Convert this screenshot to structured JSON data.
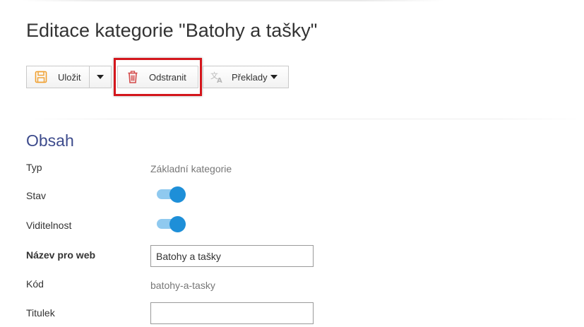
{
  "page": {
    "title": "Editace kategorie \"Batohy a tašky\""
  },
  "toolbar": {
    "save_label": "Uložit",
    "delete_label": "Odstranit",
    "translations_label": "Překlady",
    "icons": {
      "save": "floppy-disk-icon",
      "delete": "trash-icon",
      "translations": "translate-icon"
    },
    "highlight_color": "#d4161c"
  },
  "content": {
    "section_title": "Obsah",
    "fields": {
      "type": {
        "label": "Typ",
        "value": "Základní kategorie"
      },
      "status": {
        "label": "Stav",
        "enabled": true
      },
      "visibility": {
        "label": "Viditelnost",
        "enabled": true
      },
      "web_name": {
        "label": "Název pro web",
        "value": "Batohy a tašky"
      },
      "code": {
        "label": "Kód",
        "value": "batohy-a-tasky"
      },
      "title": {
        "label": "Titulek",
        "value": ""
      }
    }
  },
  "colors": {
    "section_title": "#3d4b8c",
    "toggle_knob": "#1e8fd8",
    "toggle_track": "#8fc9ef",
    "save_icon": "#f0a030",
    "delete_icon": "#d44a4a"
  }
}
